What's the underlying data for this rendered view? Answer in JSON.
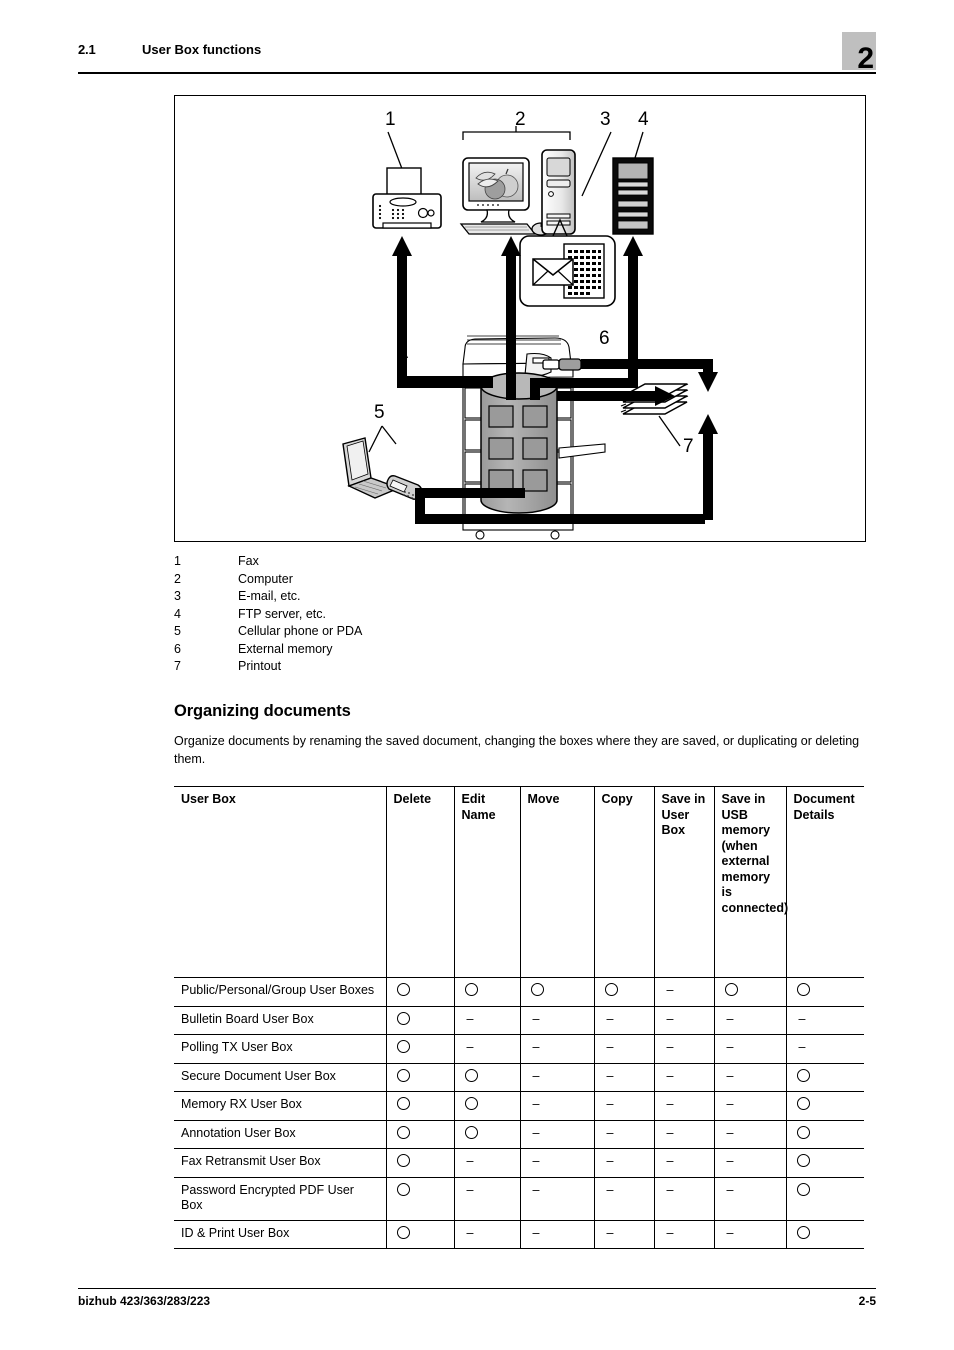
{
  "header": {
    "section_number": "2.1",
    "section_title": "User Box functions",
    "chapter_tab": "2"
  },
  "figure": {
    "callouts": [
      {
        "id": "1",
        "target": "fax-machine"
      },
      {
        "id": "2",
        "target": "computer"
      },
      {
        "id": "3",
        "target": "email-document"
      },
      {
        "id": "4",
        "target": "ftp-server"
      },
      {
        "id": "5",
        "target": "laptop-and-cellphone"
      },
      {
        "id": "6",
        "target": "external-memory-stick"
      },
      {
        "id": "7",
        "target": "printout-stack"
      }
    ],
    "icons": {
      "fax": "fax-machine-icon",
      "monitor": "computer-monitor-icon",
      "tower": "computer-tower-icon",
      "keyboard": "keyboard-icon",
      "mouse": "mouse-icon",
      "envelope": "envelope-icon",
      "document": "text-document-icon",
      "server": "server-rack-icon",
      "mfp": "mfp-printer-icon",
      "storage": "hdd-storage-cylinder-icon",
      "laptop": "laptop-icon",
      "cellphone": "cellphone-icon",
      "usb": "usb-memory-icon",
      "paper_stack": "paper-stack-icon"
    }
  },
  "legend": [
    {
      "num": "1",
      "label": "Fax"
    },
    {
      "num": "2",
      "label": "Computer"
    },
    {
      "num": "3",
      "label": "E-mail, etc."
    },
    {
      "num": "4",
      "label": "FTP server, etc."
    },
    {
      "num": "5",
      "label": "Cellular phone or PDA"
    },
    {
      "num": "6",
      "label": "External memory"
    },
    {
      "num": "7",
      "label": "Printout"
    }
  ],
  "section": {
    "heading": "Organizing documents",
    "paragraph": "Organize documents by renaming the saved document, changing the boxes where they are saved, or duplicating or deleting them."
  },
  "table": {
    "headers": [
      "User Box",
      "Delete",
      "Edit Name",
      "Move",
      "Copy",
      "Save in User Box",
      "Save in USB memory (when external memory is connected)",
      "Document Details"
    ],
    "rows": [
      {
        "name": "Public/Personal/Group User Boxes",
        "values": [
          "circle",
          "circle",
          "circle",
          "circle",
          "dash",
          "circle",
          "circle"
        ]
      },
      {
        "name": "Bulletin Board User Box",
        "values": [
          "circle",
          "dash",
          "dash",
          "dash",
          "dash",
          "dash",
          "dash"
        ]
      },
      {
        "name": "Polling TX User Box",
        "values": [
          "circle",
          "dash",
          "dash",
          "dash",
          "dash",
          "dash",
          "dash"
        ]
      },
      {
        "name": "Secure Document User Box",
        "values": [
          "circle",
          "circle",
          "dash",
          "dash",
          "dash",
          "dash",
          "circle"
        ]
      },
      {
        "name": "Memory RX User Box",
        "values": [
          "circle",
          "circle",
          "dash",
          "dash",
          "dash",
          "dash",
          "circle"
        ]
      },
      {
        "name": "Annotation User Box",
        "values": [
          "circle",
          "circle",
          "dash",
          "dash",
          "dash",
          "dash",
          "circle"
        ]
      },
      {
        "name": "Fax Retransmit User Box",
        "values": [
          "circle",
          "dash",
          "dash",
          "dash",
          "dash",
          "dash",
          "circle"
        ]
      },
      {
        "name": "Password Encrypted PDF User Box",
        "values": [
          "circle",
          "dash",
          "dash",
          "dash",
          "dash",
          "dash",
          "circle"
        ]
      },
      {
        "name": "ID & Print User Box",
        "values": [
          "circle",
          "dash",
          "dash",
          "dash",
          "dash",
          "dash",
          "circle"
        ]
      }
    ],
    "symbols": {
      "circle": "○",
      "dash": "–"
    }
  },
  "footer": {
    "product": "bizhub 423/363/283/223",
    "page_number": "2-5"
  }
}
